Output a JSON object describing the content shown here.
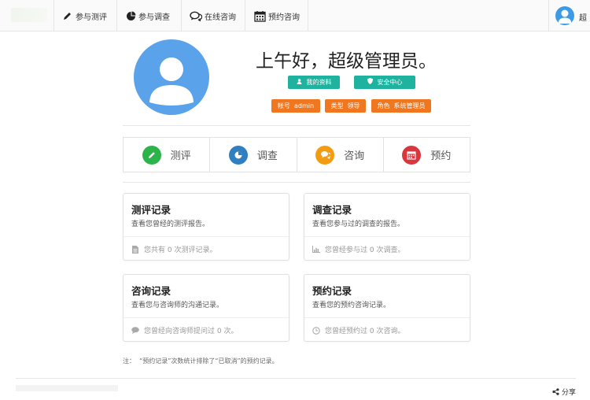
{
  "nav": {
    "items": [
      {
        "label": "参与测评",
        "icon": "pencil-icon"
      },
      {
        "label": "参与调查",
        "icon": "pie-chart-icon"
      },
      {
        "label": "在线咨询",
        "icon": "chat-icon"
      },
      {
        "label": "预约咨询",
        "icon": "calendar-icon"
      }
    ],
    "user_name_truncated": "超"
  },
  "header": {
    "greeting": "上午好，超级管理员。",
    "my_profile_label": "我的资料",
    "security_label": "安全中心",
    "account_label": "帐号",
    "account_value": "admin",
    "type_label": "类型",
    "type_value": "领导",
    "role_label": "角色",
    "role_value": "系统管理员"
  },
  "quick_menu": [
    {
      "label": "测评",
      "color": "#2cb34a",
      "icon": "pencil-icon"
    },
    {
      "label": "调查",
      "color": "#2f7fc1",
      "icon": "pie-chart-icon"
    },
    {
      "label": "咨询",
      "color": "#f39c12",
      "icon": "chat-icon"
    },
    {
      "label": "预约",
      "color": "#d9363e",
      "icon": "calendar-icon"
    }
  ],
  "cards": {
    "assessment": {
      "title": "测评记录",
      "desc": "查看您曾经的测评报告。",
      "foot": "您共有 0 次测评记录。"
    },
    "survey": {
      "title": "调查记录",
      "desc": "查看您参与过的调查的报告。",
      "foot": "您曾经参与过 0 次调查。"
    },
    "consult": {
      "title": "咨询记录",
      "desc": "查看您与咨询师的沟通记录。",
      "foot": "您曾经向咨询师提问过 0 次。"
    },
    "appointment": {
      "title": "预约记录",
      "desc": "查看您的预约咨询记录。",
      "foot": "您曾经预约过 0 次咨询。"
    }
  },
  "note": "注：  “预约记录”次数统计排除了“已取消”的预约记录。",
  "footer": {
    "share_label": "分享"
  },
  "colors": {
    "teal": "#1fb29f",
    "orange": "#f0771f",
    "avatar_blue": "#5aa3ea"
  }
}
